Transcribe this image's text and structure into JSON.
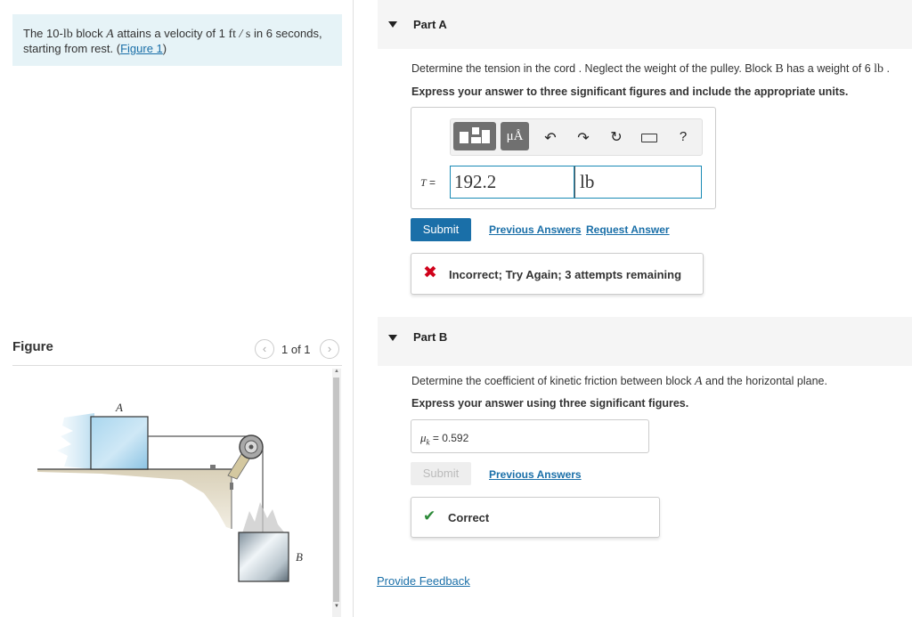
{
  "problem": {
    "text_a": "The 10-",
    "unit_lb": "lb",
    "text_b": " block ",
    "var_A": "A",
    "text_c": " attains a velocity of 1 ",
    "unit_ft": "ft",
    "slash": " / ",
    "unit_s": "s",
    "text_d": " in 6 seconds, starting from rest. (",
    "figure_link": "Figure 1",
    "text_e": ")"
  },
  "figure": {
    "title": "Figure",
    "counter": "1 of 1",
    "label_A": "A",
    "label_B": "B"
  },
  "partA": {
    "title": "Part A",
    "question_a": "Determine the tension in the cord . Neglect the weight of the pulley. Block ",
    "var_B": "B",
    "question_b": " has a weight of 6 ",
    "unit_lb": "lb",
    "question_c": " .",
    "instruction": "Express your answer to three significant figures and include the appropriate units.",
    "toolbar": {
      "mu_label": "μÅ",
      "help_label": "?"
    },
    "var_label": "T",
    "equals": " =",
    "value": "192.2",
    "unit": "lb",
    "submit_label": "Submit",
    "previous_answers": "Previous Answers",
    "request_answer": "Request Answer",
    "feedback": "Incorrect; Try Again; 3 attempts remaining",
    "feedback_color": "#d0021b"
  },
  "partB": {
    "title": "Part B",
    "question_a": "Determine the coefficient of kinetic friction between block ",
    "var_A": "A",
    "question_b": " and the horizontal plane.",
    "instruction": "Express your answer using three significant figures.",
    "var_label": "μ",
    "var_sub": "k",
    "equals": " = ",
    "value": "0.592",
    "submit_label": "Submit",
    "previous_answers": "Previous Answers",
    "feedback": "Correct",
    "feedback_color": "#2e8b3a"
  },
  "footer": {
    "provide_feedback": "Provide Feedback"
  }
}
